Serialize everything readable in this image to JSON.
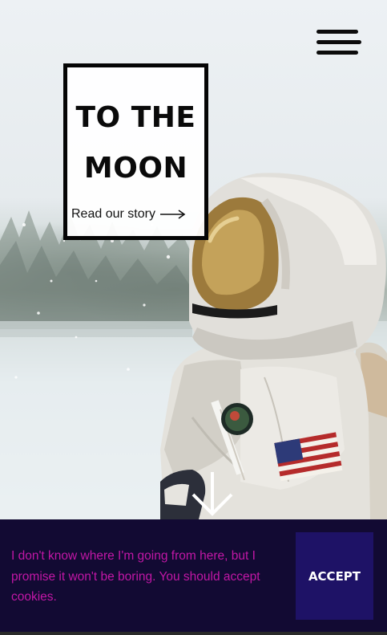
{
  "hero": {
    "title_line_1": "TO THE",
    "title_line_2": "MOON",
    "story_link": "Read our story",
    "story_arrow_icon": "long-right-arrow-icon",
    "scroll_icon": "arrow-down-icon",
    "menu_icon": "hamburger-menu-icon",
    "image": "astronaut in spacesuit in snowy forest"
  },
  "cookie_banner": {
    "message": "I don't know where I'm going from here, but I promise it won't be boring. You should accept cookies.",
    "accept_label": "ACCEPT",
    "background": "#120a33",
    "text_color": "#c217a6",
    "button_color": "#1e1266"
  }
}
